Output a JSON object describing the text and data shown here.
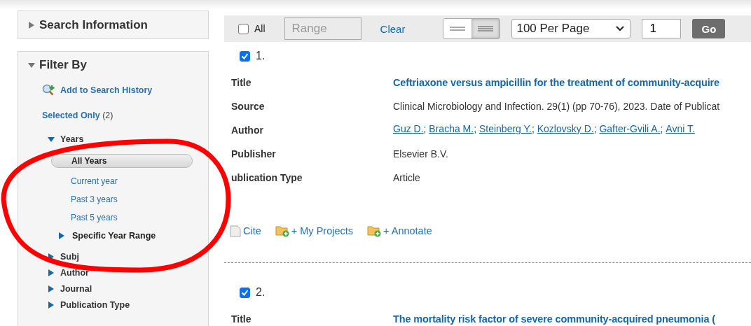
{
  "sidebar": {
    "search_information": {
      "label": "Search Information",
      "expanded": false
    },
    "filter_by": {
      "label": "Filter By",
      "expanded": true,
      "links": [
        {
          "label": "Add to Search History",
          "kind": "history"
        },
        {
          "label": "Selected Only",
          "count": "(2)",
          "kind": "plain"
        }
      ],
      "facets": [
        {
          "label": "Years",
          "expanded": true,
          "options": [
            {
              "label": "All Years",
              "kind": "option",
              "selected": true
            },
            {
              "label": "Current year",
              "kind": "option",
              "selected": false
            },
            {
              "label": "Past 3 years",
              "kind": "option",
              "selected": false
            },
            {
              "label": "Past 5 years",
              "kind": "option",
              "selected": false
            },
            {
              "label": "Specific Year Range",
              "kind": "group",
              "expanded": false
            }
          ]
        },
        {
          "label": "Subj",
          "expanded": false
        },
        {
          "label": "Author",
          "expanded": false
        },
        {
          "label": "Journal",
          "expanded": false
        },
        {
          "label": "Publication Type",
          "expanded": false
        }
      ]
    }
  },
  "toolbar": {
    "select_all": {
      "label": "All",
      "checked": false
    },
    "range": {
      "placeholder": "Range"
    },
    "clear": "Clear",
    "view_toggle": [
      {
        "kind": "title",
        "selected": false
      },
      {
        "kind": "brief",
        "selected": true
      }
    ],
    "per_page": "100 Per Page",
    "page": "1",
    "go": "Go"
  },
  "records": [
    {
      "number": "1.",
      "checked": true,
      "fields": [
        {
          "label": "Title",
          "kind": "title",
          "value": "Ceftriaxone versus ampicillin for the treatment of community-acquire"
        },
        {
          "label": "Source",
          "kind": "text",
          "value": "Clinical Microbiology and Infection. 29(1) (pp 70-76), 2023. Date of Publicat"
        },
        {
          "label": "Author",
          "kind": "authors",
          "separator": ";",
          "authors": [
            "Guz D.",
            "Bracha M.",
            "Steinberg Y.",
            "Kozlovsky D.",
            "Gafter-Gvili A.",
            "Avni T."
          ]
        },
        {
          "label": "Publisher",
          "kind": "text",
          "value": "Elsevier B.V."
        },
        {
          "label": "ublication Type",
          "kind": "text",
          "value": "Article"
        }
      ],
      "actions": [
        {
          "label": "Cite",
          "kind": "cite"
        },
        {
          "label": "+ My Projects",
          "kind": "folder"
        },
        {
          "label": "+ Annotate",
          "kind": "folder"
        }
      ]
    },
    {
      "number": "2.",
      "checked": true,
      "fields": [
        {
          "label": "Title",
          "kind": "title",
          "value": "The mortality risk factor of severe community-acquired pneumonia ("
        }
      ]
    }
  ],
  "annotation": {
    "kind": "ellipse",
    "color": "#ff0000"
  }
}
